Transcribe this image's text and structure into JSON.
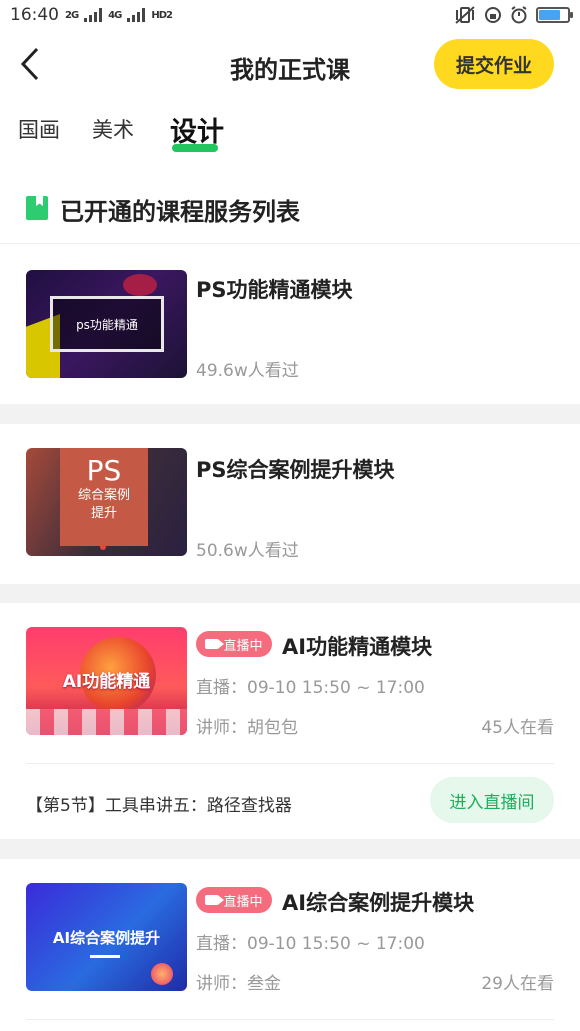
{
  "status_bar": {
    "time": "16:40",
    "signal1": "2G",
    "signal2": "4G",
    "hd": "HD2",
    "battery_level": 0.75
  },
  "header": {
    "title": "我的正式课",
    "submit_label": "提交作业"
  },
  "tabs": [
    {
      "label": "国画"
    },
    {
      "label": "美术"
    },
    {
      "label": "设计"
    }
  ],
  "section": {
    "title": "已开通的课程服务列表"
  },
  "courses": [
    {
      "title": "PS功能精通模块",
      "views": "49.6w人看过",
      "thumb_text": "ps功能精通"
    },
    {
      "title": "PS综合案例提升模块",
      "views": "50.6w人看过",
      "thumb_big": "PS",
      "thumb_line1": "综合案例",
      "thumb_line2": "提升"
    }
  ],
  "live_courses": [
    {
      "badge": "直播中",
      "title": "AI功能精通模块",
      "time": "直播：09-10 15:50 ~ 17:00",
      "teacher": "讲师：胡包包",
      "watching": "45人在看",
      "lesson": "【第5节】工具串讲五：路径查找器",
      "enter_label": "进入直播间",
      "thumb_text": "AI功能精通"
    },
    {
      "badge": "直播中",
      "title": "AI综合案例提升模块",
      "time": "直播：09-10 15:50 ~ 17:00",
      "teacher": "讲师：叁金",
      "watching": "29人在看",
      "thumb_text": "AI综合案例提升"
    }
  ],
  "colors": {
    "accent_yellow": "#ffd91f",
    "accent_green": "#22c55e",
    "live_pink": "#f56c7f"
  }
}
